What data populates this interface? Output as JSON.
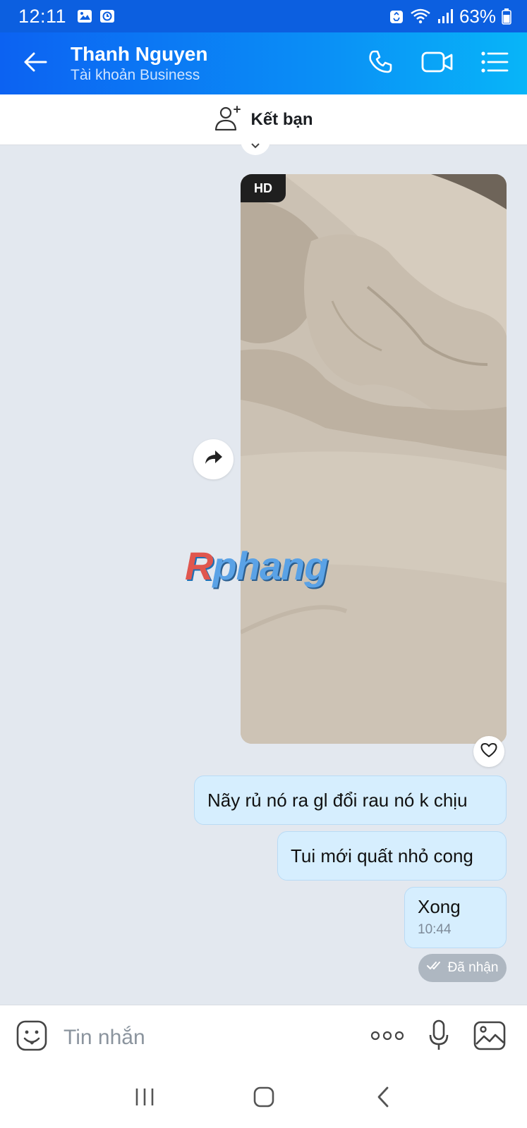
{
  "status_bar": {
    "time": "12:11",
    "battery": "63%",
    "icons": [
      "gallery-icon",
      "clock-app-icon",
      "recycle-icon",
      "wifi-icon",
      "signal-icon",
      "battery-icon"
    ]
  },
  "header": {
    "contact_name": "Thanh Nguyen",
    "contact_subtitle": "Tài khoản Business",
    "icons": [
      "back-arrow-icon",
      "phone-icon",
      "video-call-icon",
      "menu-list-icon"
    ]
  },
  "friend_bar": {
    "label": "Kết bạn",
    "icon": "add-friend-icon"
  },
  "video_message": {
    "badge": "HD",
    "watermark": {
      "first": "R",
      "rest": "phang"
    }
  },
  "messages": [
    {
      "text": "Nãy rủ nó ra gl đổi rau nó k chịu"
    },
    {
      "text": "Tui mới quất nhỏ cong"
    },
    {
      "text": "Xong",
      "time": "10:44"
    }
  ],
  "delivery_status": "Đã nhận",
  "input_bar": {
    "placeholder": "Tin nhắn",
    "icons": [
      "emoji-icon",
      "more-dots-icon",
      "microphone-icon",
      "image-icon"
    ]
  },
  "nav_bar": {
    "icons": [
      "recent-apps-icon",
      "home-icon",
      "back-icon"
    ]
  },
  "colors": {
    "header_start": "#0c62f2",
    "header_end": "#08b5f8",
    "chat_background": "#e3e8ef",
    "bubble": "#d6eefe"
  }
}
